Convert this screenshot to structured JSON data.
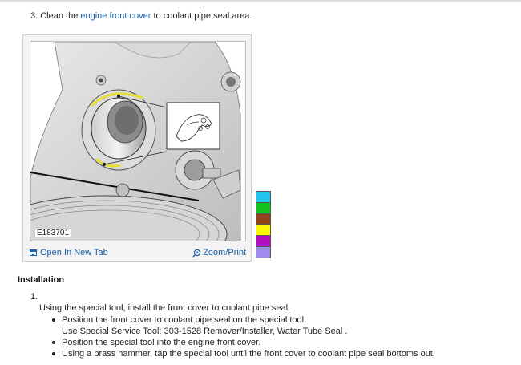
{
  "step3": {
    "prefix": "3. Clean the ",
    "link": "engine front cover",
    "suffix": " to coolant pipe seal area."
  },
  "figure": {
    "id_label": "E183701",
    "open_tab_label": "Open In New Tab",
    "zoom_label": "Zoom/Print"
  },
  "swatch_colors": [
    "#21c3f1",
    "#13c21d",
    "#8e4513",
    "#fbf807",
    "#b30fbf",
    "#9f8bee"
  ],
  "installation": {
    "heading": "Installation",
    "step_number": "1.",
    "step_text": "Using the special tool, install the front cover to coolant pipe seal.",
    "bullets": [
      {
        "text": "Position the front cover to coolant pipe seal on the special tool.",
        "subtext": "Use Special Service Tool: 303-1528 Remover/Installer, Water Tube Seal ."
      },
      {
        "text": "Position the special tool into the engine front cover."
      },
      {
        "text": "Using a brass hammer, tap the special tool until the front cover to coolant pipe seal bottoms out."
      }
    ]
  }
}
